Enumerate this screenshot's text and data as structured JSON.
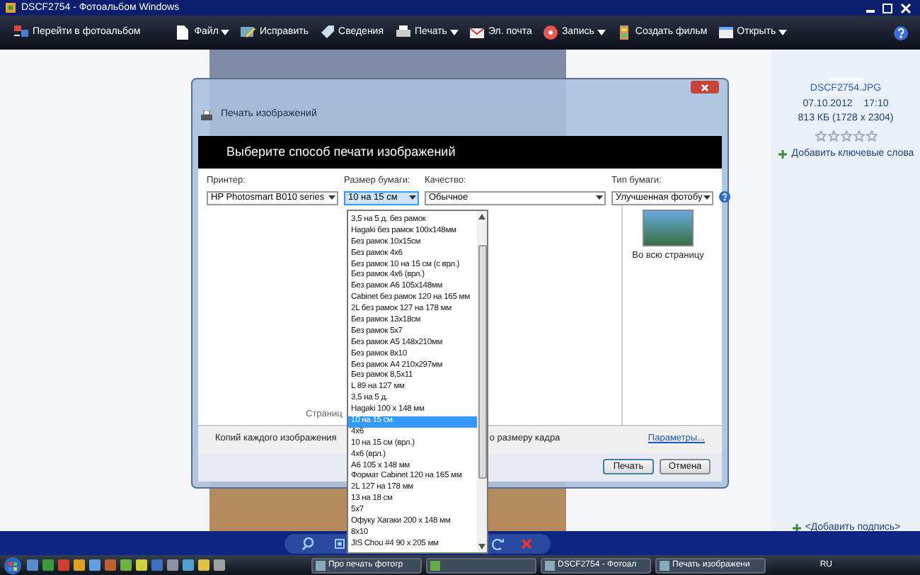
{
  "window": {
    "title": "DSCF2754 - Фотоальбом Windows"
  },
  "toolbar": {
    "items": [
      {
        "label": "Перейти в фотоальбом",
        "menu": false
      },
      {
        "label": "Файл",
        "menu": true
      },
      {
        "label": "Исправить",
        "menu": false
      },
      {
        "label": "Сведения",
        "menu": false
      },
      {
        "label": "Печать",
        "menu": true
      },
      {
        "label": "Эл. почта",
        "menu": false
      },
      {
        "label": "Запись",
        "menu": true
      },
      {
        "label": "Создать фильм",
        "menu": false
      },
      {
        "label": "Открыть",
        "menu": true
      }
    ]
  },
  "dialog": {
    "title": "Печать изображений",
    "header": "Выберите способ печати изображений",
    "fields": [
      {
        "label": "Принтер:",
        "value": "HP Photosmart B010 series",
        "focused": false
      },
      {
        "label": "Размер бумаги:",
        "value": "10 на 15 см",
        "focused": true
      },
      {
        "label": "Качество:",
        "value": "Обычное",
        "focused": false
      },
      {
        "label": "Тип бумаги:",
        "value": "Улучшенная фотобу",
        "focused": false
      }
    ],
    "paper_sizes": [
      {
        "label": "3,5 на 5 д. без рамок",
        "selected": false
      },
      {
        "label": "Hagaki без рамок 100x148мм",
        "selected": false
      },
      {
        "label": "Без рамок 10x15см",
        "selected": false
      },
      {
        "label": "Без рамок 4x6",
        "selected": false
      },
      {
        "label": "Без рамок 10 на 15 см (с врл.)",
        "selected": false
      },
      {
        "label": "Без рамок 4x6 (врл.)",
        "selected": false
      },
      {
        "label": "Без рамок A6 105x148мм",
        "selected": false
      },
      {
        "label": "Cabinet без рамок 120 на 165 мм",
        "selected": false
      },
      {
        "label": "2L без рамок 127 на 178 мм",
        "selected": false
      },
      {
        "label": "Без рамок 13x18см",
        "selected": false
      },
      {
        "label": "Без рамок 5x7",
        "selected": false
      },
      {
        "label": "Без рамок A5 148x210мм",
        "selected": false
      },
      {
        "label": "Без рамок 8x10",
        "selected": false
      },
      {
        "label": "Без рамок A4 210x297мм",
        "selected": false
      },
      {
        "label": "Без рамок 8,5x11",
        "selected": false
      },
      {
        "label": "L 89 на 127 мм",
        "selected": false
      },
      {
        "label": "3,5 на 5 д.",
        "selected": false
      },
      {
        "label": "Hagaki 100 x 148 мм",
        "selected": false
      },
      {
        "label": "10 на 15 см",
        "selected": true
      },
      {
        "label": "4x6",
        "selected": false
      },
      {
        "label": "10 на 15 см (врл.)",
        "selected": false
      },
      {
        "label": "4x6 (врл.)",
        "selected": false
      },
      {
        "label": "A6 105 x 148 мм",
        "selected": false
      },
      {
        "label": "Формат Cabinet 120 на 165 мм",
        "selected": false
      },
      {
        "label": "2L 127 на 178 мм",
        "selected": false
      },
      {
        "label": "13 на 18 см",
        "selected": false
      },
      {
        "label": "5x7",
        "selected": false
      },
      {
        "label": "Офуку Хагаки 200 x 148 мм",
        "selected": false
      },
      {
        "label": "8x10",
        "selected": false
      },
      {
        "label": "JIS Chou #4 90 x 205 мм",
        "selected": false
      }
    ],
    "layout": "Во всю страницу",
    "pages": "Страниц",
    "copies": "Копий каждого изображения",
    "fit": "о размеру кадра",
    "params_link": "Параметры...",
    "buttons": [
      "Печать",
      "Отмена"
    ]
  },
  "info": {
    "filename": "DSCF2754.JPG",
    "date": "07.10.2012",
    "time": "17:10",
    "size": "813 КБ (1728 x 2304)",
    "stars": 0,
    "keywords": "Добавить ключевые слова",
    "caption": "<Добавить подпись>"
  },
  "taskbar": {
    "items": [
      {
        "label": "Про печать фотогр"
      },
      {
        "label": "DSCF2754 - Фотоал"
      },
      {
        "label": "Печать изображени"
      }
    ],
    "language": "RU"
  }
}
